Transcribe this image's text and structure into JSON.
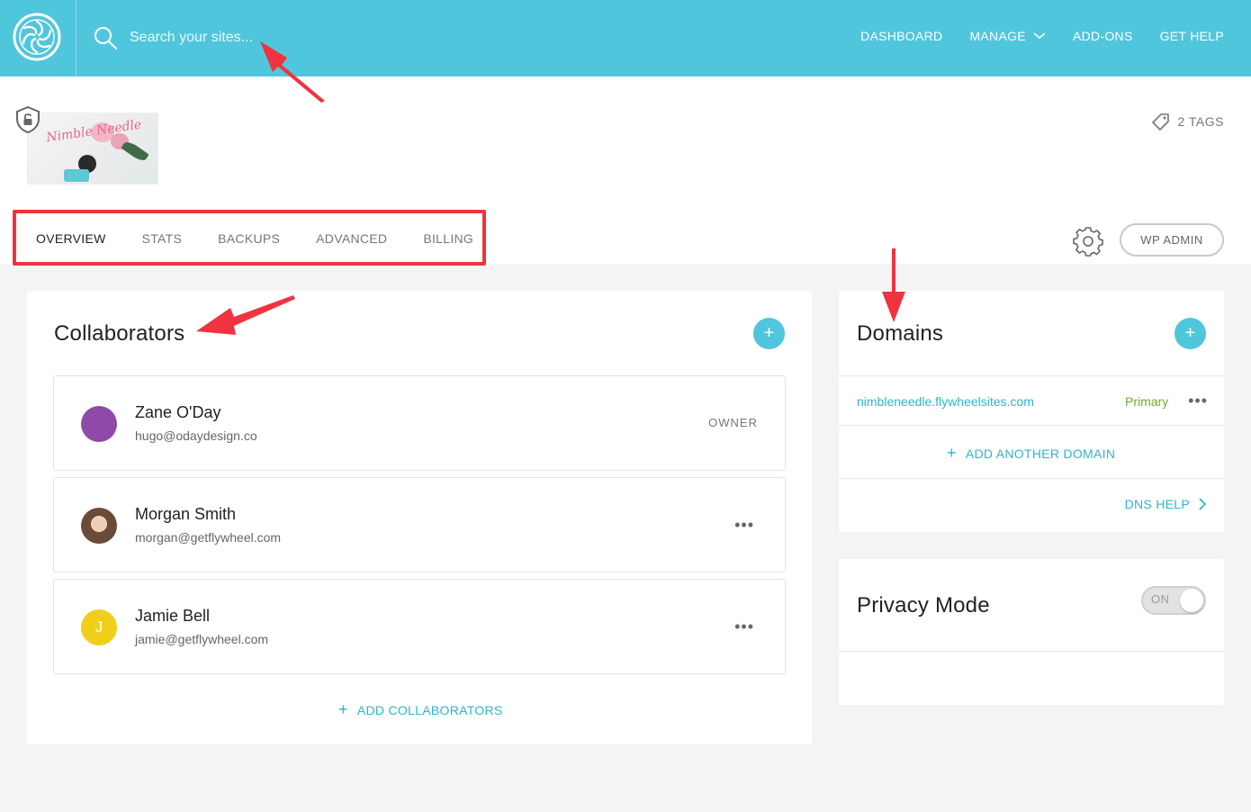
{
  "topbar": {
    "search_placeholder": "Search your sites...",
    "nav": [
      {
        "label": "DASHBOARD"
      },
      {
        "label": "MANAGE"
      },
      {
        "label": "ADD-ONS"
      },
      {
        "label": "GET HELP"
      }
    ]
  },
  "site": {
    "thumbnail_text": "Nimble Needle",
    "tags_label": "2 TAGS"
  },
  "tabs": [
    {
      "label": "OVERVIEW",
      "active": true
    },
    {
      "label": "STATS"
    },
    {
      "label": "BACKUPS"
    },
    {
      "label": "ADVANCED"
    },
    {
      "label": "BILLING"
    }
  ],
  "wp_admin_label": "WP ADMIN",
  "collaborators": {
    "title": "Collaborators",
    "add_label": "ADD COLLABORATORS",
    "people": [
      {
        "name": "Zane O'Day",
        "email": "hugo@odaydesign.co",
        "role": "OWNER",
        "avatar_color": "#8e4aa8"
      },
      {
        "name": "Morgan Smith",
        "email": "morgan@getflywheel.com",
        "role": "",
        "avatar_color": "#6b4a3a"
      },
      {
        "name": "Jamie Bell",
        "email": "jamie@getflywheel.com",
        "role": "",
        "avatar_color": "#f0cf1a",
        "initial": "J"
      }
    ]
  },
  "domains": {
    "title": "Domains",
    "items": [
      {
        "url": "nimbleneedle.flywheelsites.com",
        "status": "Primary"
      }
    ],
    "add_label": "ADD ANOTHER DOMAIN",
    "dns_help_label": "DNS HELP"
  },
  "privacy": {
    "title": "Privacy Mode",
    "toggle_label": "ON"
  },
  "colors": {
    "topbar": "#50c6dc",
    "accent": "#2fb4cd",
    "primary_status": "#6dae32",
    "annotation": "#ef3340"
  }
}
